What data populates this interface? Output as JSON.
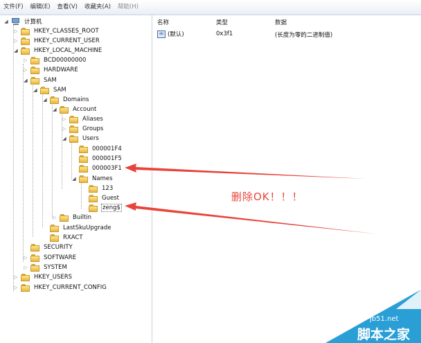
{
  "menu": [
    {
      "label": "文件(F)",
      "disabled": false
    },
    {
      "label": "编辑(E)",
      "disabled": false
    },
    {
      "label": "查看(V)",
      "disabled": false
    },
    {
      "label": "收藏夹(A)",
      "disabled": false
    },
    {
      "label": "帮助(H)",
      "disabled": true
    }
  ],
  "tree": {
    "root": "计算机",
    "nodes": [
      {
        "label": "HKEY_CLASSES_ROOT"
      },
      {
        "label": "HKEY_CURRENT_USER"
      },
      {
        "label": "HKEY_LOCAL_MACHINE"
      },
      {
        "label": "BCD00000000"
      },
      {
        "label": "HARDWARE"
      },
      {
        "label": "SAM"
      },
      {
        "label": "SAM"
      },
      {
        "label": "Domains"
      },
      {
        "label": "Account"
      },
      {
        "label": "Aliases"
      },
      {
        "label": "Groups"
      },
      {
        "label": "Users"
      },
      {
        "label": "000001F4"
      },
      {
        "label": "000001F5"
      },
      {
        "label": "000003F1"
      },
      {
        "label": "Names"
      },
      {
        "label": "123"
      },
      {
        "label": "Guest"
      },
      {
        "label": "zeng$"
      },
      {
        "label": "Builtin"
      },
      {
        "label": "LastSkuUpgrade"
      },
      {
        "label": "RXACT"
      },
      {
        "label": "SECURITY"
      },
      {
        "label": "SOFTWARE"
      },
      {
        "label": "SYSTEM"
      },
      {
        "label": "HKEY_USERS"
      },
      {
        "label": "HKEY_CURRENT_CONFIG"
      }
    ]
  },
  "list": {
    "columns": {
      "name": "名称",
      "type": "类型",
      "data": "数据"
    },
    "rows": [
      {
        "icon": "ab",
        "name": "(默认)",
        "type": "0x3f1",
        "data": "(长度为零的二进制值)"
      }
    ]
  },
  "annotation": {
    "text": "删除OK！！！",
    "color": "#e8443a"
  },
  "watermark": {
    "domain": "jb51.net",
    "name": "脚本之家",
    "color": "#2a9fd6"
  }
}
